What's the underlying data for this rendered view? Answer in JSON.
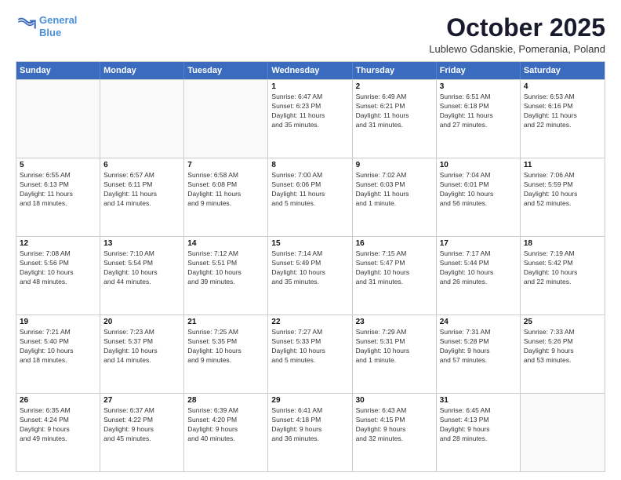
{
  "header": {
    "logo_line1": "General",
    "logo_line2": "Blue",
    "month_title": "October 2025",
    "location": "Lublewo Gdanskie, Pomerania, Poland"
  },
  "weekdays": [
    "Sunday",
    "Monday",
    "Tuesday",
    "Wednesday",
    "Thursday",
    "Friday",
    "Saturday"
  ],
  "rows": [
    [
      {
        "day": "",
        "empty": true
      },
      {
        "day": "",
        "empty": true
      },
      {
        "day": "",
        "empty": true
      },
      {
        "day": "1",
        "lines": [
          "Sunrise: 6:47 AM",
          "Sunset: 6:23 PM",
          "Daylight: 11 hours",
          "and 35 minutes."
        ]
      },
      {
        "day": "2",
        "lines": [
          "Sunrise: 6:49 AM",
          "Sunset: 6:21 PM",
          "Daylight: 11 hours",
          "and 31 minutes."
        ]
      },
      {
        "day": "3",
        "lines": [
          "Sunrise: 6:51 AM",
          "Sunset: 6:18 PM",
          "Daylight: 11 hours",
          "and 27 minutes."
        ]
      },
      {
        "day": "4",
        "lines": [
          "Sunrise: 6:53 AM",
          "Sunset: 6:16 PM",
          "Daylight: 11 hours",
          "and 22 minutes."
        ]
      }
    ],
    [
      {
        "day": "5",
        "lines": [
          "Sunrise: 6:55 AM",
          "Sunset: 6:13 PM",
          "Daylight: 11 hours",
          "and 18 minutes."
        ]
      },
      {
        "day": "6",
        "lines": [
          "Sunrise: 6:57 AM",
          "Sunset: 6:11 PM",
          "Daylight: 11 hours",
          "and 14 minutes."
        ]
      },
      {
        "day": "7",
        "lines": [
          "Sunrise: 6:58 AM",
          "Sunset: 6:08 PM",
          "Daylight: 11 hours",
          "and 9 minutes."
        ]
      },
      {
        "day": "8",
        "lines": [
          "Sunrise: 7:00 AM",
          "Sunset: 6:06 PM",
          "Daylight: 11 hours",
          "and 5 minutes."
        ]
      },
      {
        "day": "9",
        "lines": [
          "Sunrise: 7:02 AM",
          "Sunset: 6:03 PM",
          "Daylight: 11 hours",
          "and 1 minute."
        ]
      },
      {
        "day": "10",
        "lines": [
          "Sunrise: 7:04 AM",
          "Sunset: 6:01 PM",
          "Daylight: 10 hours",
          "and 56 minutes."
        ]
      },
      {
        "day": "11",
        "lines": [
          "Sunrise: 7:06 AM",
          "Sunset: 5:59 PM",
          "Daylight: 10 hours",
          "and 52 minutes."
        ]
      }
    ],
    [
      {
        "day": "12",
        "lines": [
          "Sunrise: 7:08 AM",
          "Sunset: 5:56 PM",
          "Daylight: 10 hours",
          "and 48 minutes."
        ]
      },
      {
        "day": "13",
        "lines": [
          "Sunrise: 7:10 AM",
          "Sunset: 5:54 PM",
          "Daylight: 10 hours",
          "and 44 minutes."
        ]
      },
      {
        "day": "14",
        "lines": [
          "Sunrise: 7:12 AM",
          "Sunset: 5:51 PM",
          "Daylight: 10 hours",
          "and 39 minutes."
        ]
      },
      {
        "day": "15",
        "lines": [
          "Sunrise: 7:14 AM",
          "Sunset: 5:49 PM",
          "Daylight: 10 hours",
          "and 35 minutes."
        ]
      },
      {
        "day": "16",
        "lines": [
          "Sunrise: 7:15 AM",
          "Sunset: 5:47 PM",
          "Daylight: 10 hours",
          "and 31 minutes."
        ]
      },
      {
        "day": "17",
        "lines": [
          "Sunrise: 7:17 AM",
          "Sunset: 5:44 PM",
          "Daylight: 10 hours",
          "and 26 minutes."
        ]
      },
      {
        "day": "18",
        "lines": [
          "Sunrise: 7:19 AM",
          "Sunset: 5:42 PM",
          "Daylight: 10 hours",
          "and 22 minutes."
        ]
      }
    ],
    [
      {
        "day": "19",
        "lines": [
          "Sunrise: 7:21 AM",
          "Sunset: 5:40 PM",
          "Daylight: 10 hours",
          "and 18 minutes."
        ]
      },
      {
        "day": "20",
        "lines": [
          "Sunrise: 7:23 AM",
          "Sunset: 5:37 PM",
          "Daylight: 10 hours",
          "and 14 minutes."
        ]
      },
      {
        "day": "21",
        "lines": [
          "Sunrise: 7:25 AM",
          "Sunset: 5:35 PM",
          "Daylight: 10 hours",
          "and 9 minutes."
        ]
      },
      {
        "day": "22",
        "lines": [
          "Sunrise: 7:27 AM",
          "Sunset: 5:33 PM",
          "Daylight: 10 hours",
          "and 5 minutes."
        ]
      },
      {
        "day": "23",
        "lines": [
          "Sunrise: 7:29 AM",
          "Sunset: 5:31 PM",
          "Daylight: 10 hours",
          "and 1 minute."
        ]
      },
      {
        "day": "24",
        "lines": [
          "Sunrise: 7:31 AM",
          "Sunset: 5:28 PM",
          "Daylight: 9 hours",
          "and 57 minutes."
        ]
      },
      {
        "day": "25",
        "lines": [
          "Sunrise: 7:33 AM",
          "Sunset: 5:26 PM",
          "Daylight: 9 hours",
          "and 53 minutes."
        ]
      }
    ],
    [
      {
        "day": "26",
        "lines": [
          "Sunrise: 6:35 AM",
          "Sunset: 4:24 PM",
          "Daylight: 9 hours",
          "and 49 minutes."
        ]
      },
      {
        "day": "27",
        "lines": [
          "Sunrise: 6:37 AM",
          "Sunset: 4:22 PM",
          "Daylight: 9 hours",
          "and 45 minutes."
        ]
      },
      {
        "day": "28",
        "lines": [
          "Sunrise: 6:39 AM",
          "Sunset: 4:20 PM",
          "Daylight: 9 hours",
          "and 40 minutes."
        ]
      },
      {
        "day": "29",
        "lines": [
          "Sunrise: 6:41 AM",
          "Sunset: 4:18 PM",
          "Daylight: 9 hours",
          "and 36 minutes."
        ]
      },
      {
        "day": "30",
        "lines": [
          "Sunrise: 6:43 AM",
          "Sunset: 4:15 PM",
          "Daylight: 9 hours",
          "and 32 minutes."
        ]
      },
      {
        "day": "31",
        "lines": [
          "Sunrise: 6:45 AM",
          "Sunset: 4:13 PM",
          "Daylight: 9 hours",
          "and 28 minutes."
        ]
      },
      {
        "day": "",
        "empty": true
      }
    ]
  ]
}
